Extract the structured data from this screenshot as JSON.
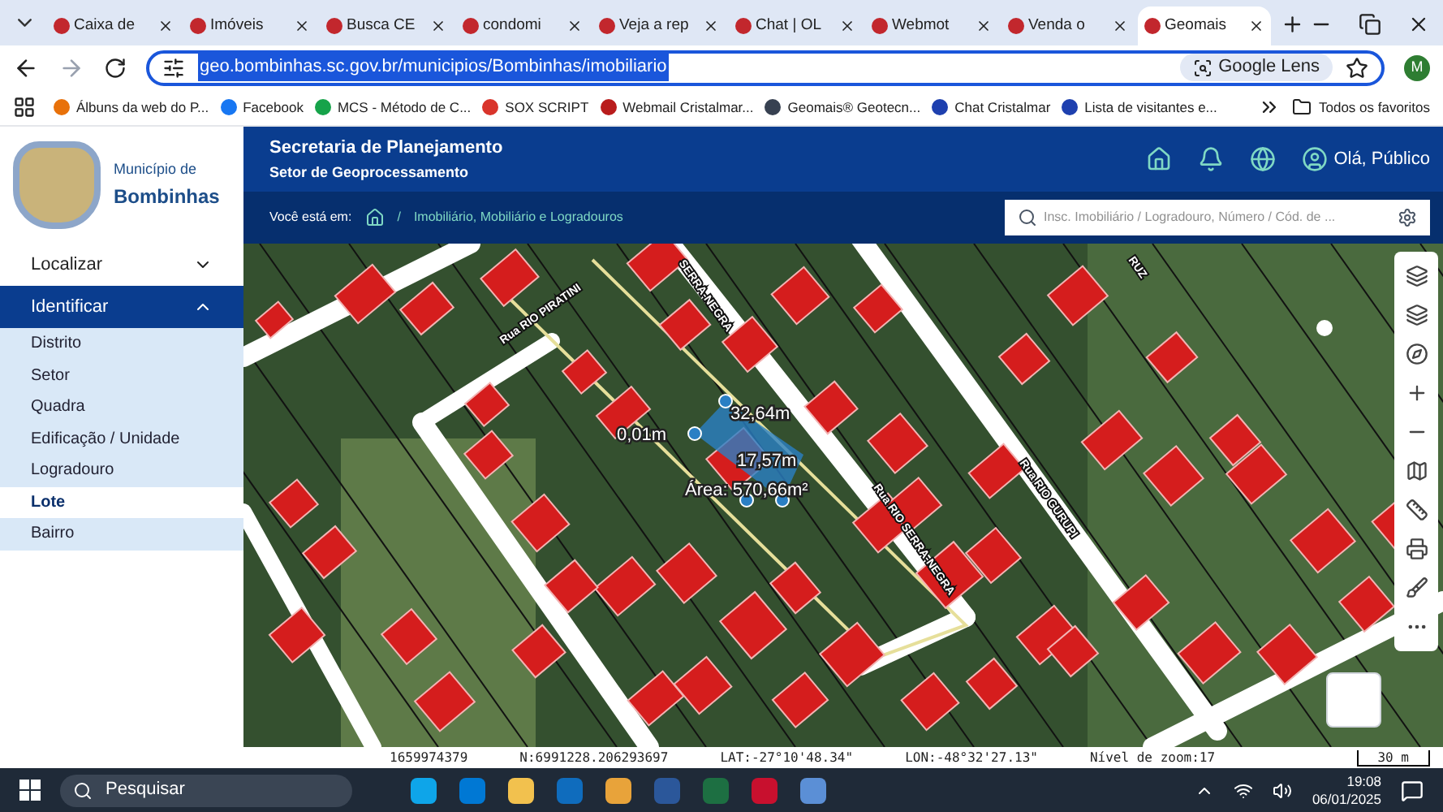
{
  "browser": {
    "tabs": [
      {
        "title": "Caixa de",
        "selected": false
      },
      {
        "title": "Imóveis",
        "selected": false
      },
      {
        "title": "Busca CE",
        "selected": false
      },
      {
        "title": "condomi",
        "selected": false
      },
      {
        "title": "Veja a rep",
        "selected": false
      },
      {
        "title": "Chat | OL",
        "selected": false
      },
      {
        "title": "Webmot",
        "selected": false
      },
      {
        "title": "Venda o",
        "selected": false
      },
      {
        "title": "Geomais",
        "selected": true
      }
    ],
    "url": "geo.bombinhas.sc.gov.br/municipios/Bombinhas/imobiliario",
    "lens_label": "Google Lens",
    "profile_initial": "M",
    "bookmarks": [
      "Álbuns da web do P...",
      "Facebook",
      "MCS - Método de C...",
      "SOX SCRIPT",
      "Webmail Cristalmar...",
      "Geomais® Geotecn...",
      "Chat Cristalmar",
      "Lista de visitantes e..."
    ],
    "all_bookmarks": "Todos os favoritos"
  },
  "header": {
    "municipality_prefix": "Município de",
    "municipality": "Bombinhas",
    "title": "Secretaria de Planejamento",
    "subtitle": "Setor de Geoprocessamento",
    "greeting": "Olá, Público",
    "breadcrumb_label": "Você está em:",
    "breadcrumb_separator": "/",
    "breadcrumb_page": "Imobiliário, Mobiliário e Logradouros",
    "search": {
      "placeholder": "Insc. Imobiliário / Logradouro, Número / Cód. de ..."
    }
  },
  "sidebar": {
    "items": [
      {
        "label": "Localizar",
        "expanded": false
      },
      {
        "label": "Identificar",
        "expanded": true,
        "children": [
          {
            "label": "Distrito",
            "selected": false
          },
          {
            "label": "Setor",
            "selected": false
          },
          {
            "label": "Quadra",
            "selected": false
          },
          {
            "label": "Edificação / Unidade",
            "selected": false
          },
          {
            "label": "Logradouro",
            "selected": false
          },
          {
            "label": "Lote",
            "selected": true
          },
          {
            "label": "Bairro",
            "selected": false
          }
        ]
      }
    ]
  },
  "map": {
    "street_labels": [
      "Rua RIO PIRATINI",
      "SERRA-NEGRA",
      "Rua RIO SERRA-NEGRA",
      "Rua RIO GURUPI",
      "RUZ"
    ],
    "measurements": [
      "32,64m",
      "0,01m",
      "17,57m",
      "Área: 570,66m²"
    ]
  },
  "status_bar": {
    "items": [
      "1659974379",
      "N:6991228.206293697",
      "LAT:-27°10'48.34\"",
      "LON:-48°32'27.13\"",
      "Nível de zoom:17"
    ],
    "scale": "30 m"
  },
  "taskbar": {
    "search_placeholder": "Pesquisar",
    "time": "19:08",
    "date": "06/01/2025"
  }
}
